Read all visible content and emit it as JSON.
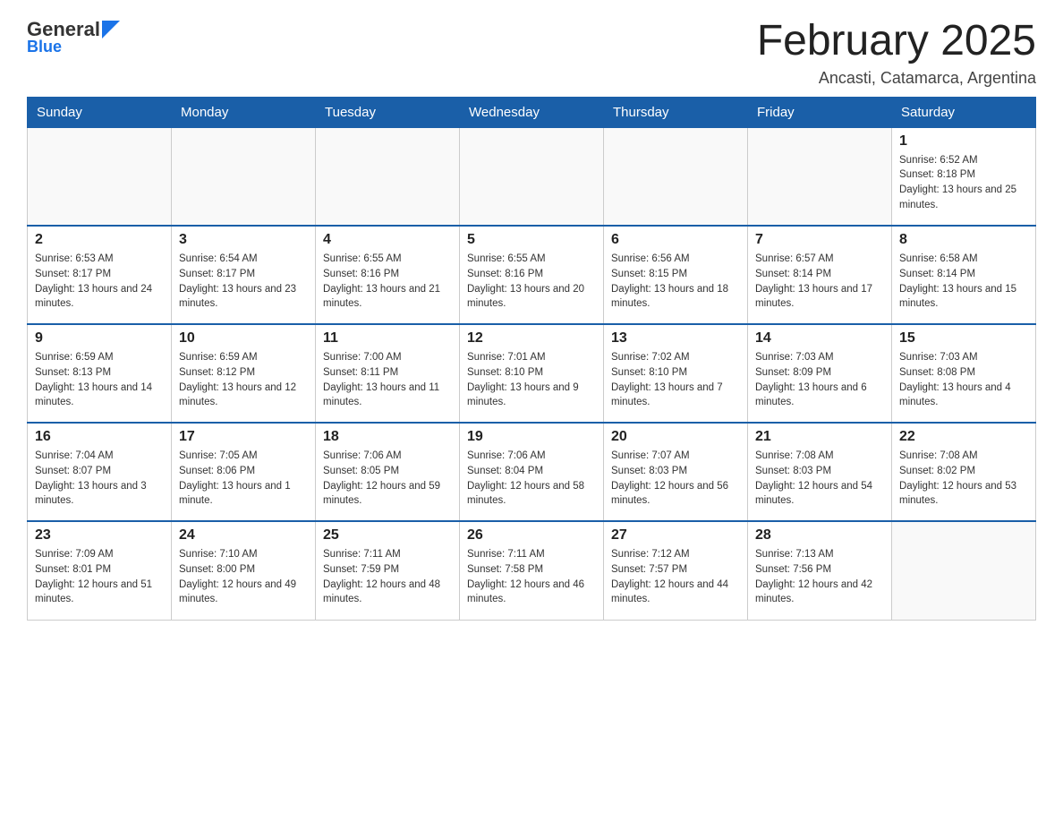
{
  "header": {
    "logo_general": "General",
    "logo_blue": "Blue",
    "month_title": "February 2025",
    "location": "Ancasti, Catamarca, Argentina"
  },
  "weekdays": [
    "Sunday",
    "Monday",
    "Tuesday",
    "Wednesday",
    "Thursday",
    "Friday",
    "Saturday"
  ],
  "weeks": [
    [
      {
        "day": "",
        "info": ""
      },
      {
        "day": "",
        "info": ""
      },
      {
        "day": "",
        "info": ""
      },
      {
        "day": "",
        "info": ""
      },
      {
        "day": "",
        "info": ""
      },
      {
        "day": "",
        "info": ""
      },
      {
        "day": "1",
        "info": "Sunrise: 6:52 AM\nSunset: 8:18 PM\nDaylight: 13 hours and 25 minutes."
      }
    ],
    [
      {
        "day": "2",
        "info": "Sunrise: 6:53 AM\nSunset: 8:17 PM\nDaylight: 13 hours and 24 minutes."
      },
      {
        "day": "3",
        "info": "Sunrise: 6:54 AM\nSunset: 8:17 PM\nDaylight: 13 hours and 23 minutes."
      },
      {
        "day": "4",
        "info": "Sunrise: 6:55 AM\nSunset: 8:16 PM\nDaylight: 13 hours and 21 minutes."
      },
      {
        "day": "5",
        "info": "Sunrise: 6:55 AM\nSunset: 8:16 PM\nDaylight: 13 hours and 20 minutes."
      },
      {
        "day": "6",
        "info": "Sunrise: 6:56 AM\nSunset: 8:15 PM\nDaylight: 13 hours and 18 minutes."
      },
      {
        "day": "7",
        "info": "Sunrise: 6:57 AM\nSunset: 8:14 PM\nDaylight: 13 hours and 17 minutes."
      },
      {
        "day": "8",
        "info": "Sunrise: 6:58 AM\nSunset: 8:14 PM\nDaylight: 13 hours and 15 minutes."
      }
    ],
    [
      {
        "day": "9",
        "info": "Sunrise: 6:59 AM\nSunset: 8:13 PM\nDaylight: 13 hours and 14 minutes."
      },
      {
        "day": "10",
        "info": "Sunrise: 6:59 AM\nSunset: 8:12 PM\nDaylight: 13 hours and 12 minutes."
      },
      {
        "day": "11",
        "info": "Sunrise: 7:00 AM\nSunset: 8:11 PM\nDaylight: 13 hours and 11 minutes."
      },
      {
        "day": "12",
        "info": "Sunrise: 7:01 AM\nSunset: 8:10 PM\nDaylight: 13 hours and 9 minutes."
      },
      {
        "day": "13",
        "info": "Sunrise: 7:02 AM\nSunset: 8:10 PM\nDaylight: 13 hours and 7 minutes."
      },
      {
        "day": "14",
        "info": "Sunrise: 7:03 AM\nSunset: 8:09 PM\nDaylight: 13 hours and 6 minutes."
      },
      {
        "day": "15",
        "info": "Sunrise: 7:03 AM\nSunset: 8:08 PM\nDaylight: 13 hours and 4 minutes."
      }
    ],
    [
      {
        "day": "16",
        "info": "Sunrise: 7:04 AM\nSunset: 8:07 PM\nDaylight: 13 hours and 3 minutes."
      },
      {
        "day": "17",
        "info": "Sunrise: 7:05 AM\nSunset: 8:06 PM\nDaylight: 13 hours and 1 minute."
      },
      {
        "day": "18",
        "info": "Sunrise: 7:06 AM\nSunset: 8:05 PM\nDaylight: 12 hours and 59 minutes."
      },
      {
        "day": "19",
        "info": "Sunrise: 7:06 AM\nSunset: 8:04 PM\nDaylight: 12 hours and 58 minutes."
      },
      {
        "day": "20",
        "info": "Sunrise: 7:07 AM\nSunset: 8:03 PM\nDaylight: 12 hours and 56 minutes."
      },
      {
        "day": "21",
        "info": "Sunrise: 7:08 AM\nSunset: 8:03 PM\nDaylight: 12 hours and 54 minutes."
      },
      {
        "day": "22",
        "info": "Sunrise: 7:08 AM\nSunset: 8:02 PM\nDaylight: 12 hours and 53 minutes."
      }
    ],
    [
      {
        "day": "23",
        "info": "Sunrise: 7:09 AM\nSunset: 8:01 PM\nDaylight: 12 hours and 51 minutes."
      },
      {
        "day": "24",
        "info": "Sunrise: 7:10 AM\nSunset: 8:00 PM\nDaylight: 12 hours and 49 minutes."
      },
      {
        "day": "25",
        "info": "Sunrise: 7:11 AM\nSunset: 7:59 PM\nDaylight: 12 hours and 48 minutes."
      },
      {
        "day": "26",
        "info": "Sunrise: 7:11 AM\nSunset: 7:58 PM\nDaylight: 12 hours and 46 minutes."
      },
      {
        "day": "27",
        "info": "Sunrise: 7:12 AM\nSunset: 7:57 PM\nDaylight: 12 hours and 44 minutes."
      },
      {
        "day": "28",
        "info": "Sunrise: 7:13 AM\nSunset: 7:56 PM\nDaylight: 12 hours and 42 minutes."
      },
      {
        "day": "",
        "info": ""
      }
    ]
  ]
}
